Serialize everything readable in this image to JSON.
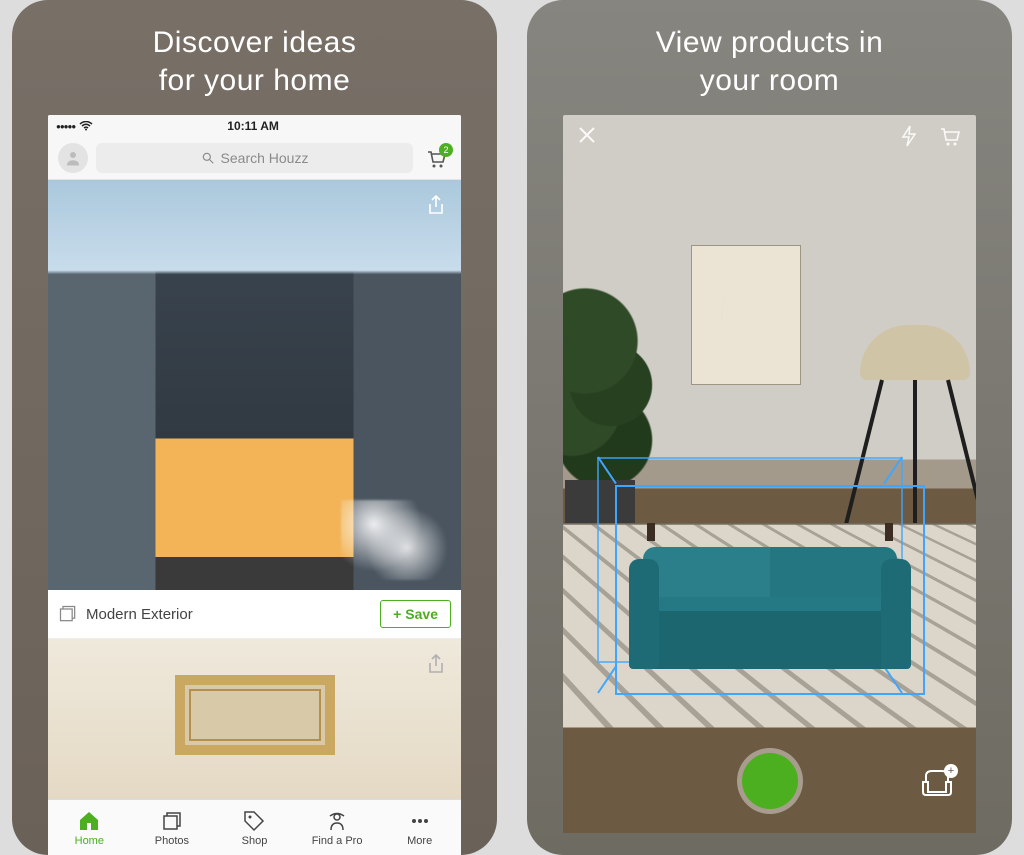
{
  "left": {
    "headline_line1": "Discover ideas",
    "headline_line2": "for your home",
    "status": {
      "time": "10:11 AM"
    },
    "search": {
      "placeholder": "Search Houzz"
    },
    "cart": {
      "badge": "2"
    },
    "card": {
      "title": "Modern Exterior",
      "save_label": "Save",
      "save_plus": "+"
    },
    "tabs": [
      {
        "label": "Home"
      },
      {
        "label": "Photos"
      },
      {
        "label": "Shop"
      },
      {
        "label": "Find a Pro"
      },
      {
        "label": "More"
      }
    ]
  },
  "right": {
    "headline_line1": "View products in",
    "headline_line2": "your room",
    "add_plus": "+"
  },
  "colors": {
    "accent": "#4caf1f",
    "ar_box": "#3fa6ff"
  }
}
